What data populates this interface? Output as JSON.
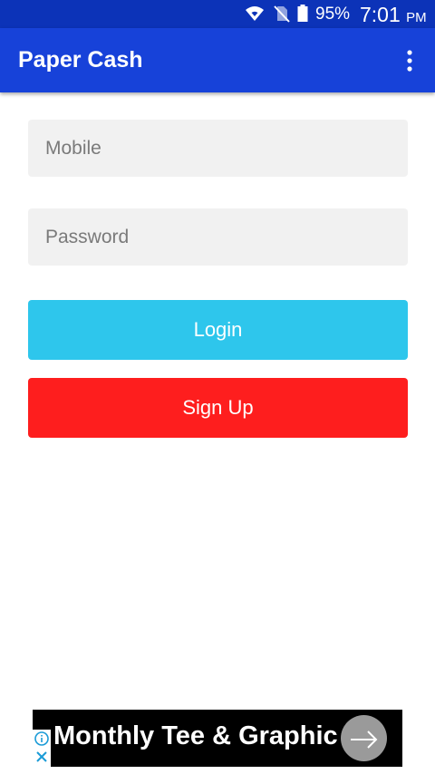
{
  "status_bar": {
    "battery_percent": "95%",
    "time": "7:01",
    "am_pm": "PM",
    "icons": [
      "wifi-icon",
      "no-sim-icon",
      "battery-icon"
    ]
  },
  "app_bar": {
    "title": "Paper Cash",
    "overflow_icon": "more-vert-icon"
  },
  "form": {
    "mobile": {
      "placeholder": "Mobile",
      "value": ""
    },
    "password": {
      "placeholder": "Password",
      "value": ""
    },
    "login_label": "Login",
    "signup_label": "Sign Up"
  },
  "ad": {
    "text": "Monthly Tee & Graphic I",
    "icons": [
      "info-icon",
      "close-icon",
      "arrow-right-icon"
    ]
  },
  "colors": {
    "status_bar": "#0c33b8",
    "app_bar": "#1742d9",
    "login_button": "#2ec6ec",
    "signup_button": "#fe1e1e",
    "field_background": "#f1f1f1",
    "ad_background": "#000000"
  }
}
